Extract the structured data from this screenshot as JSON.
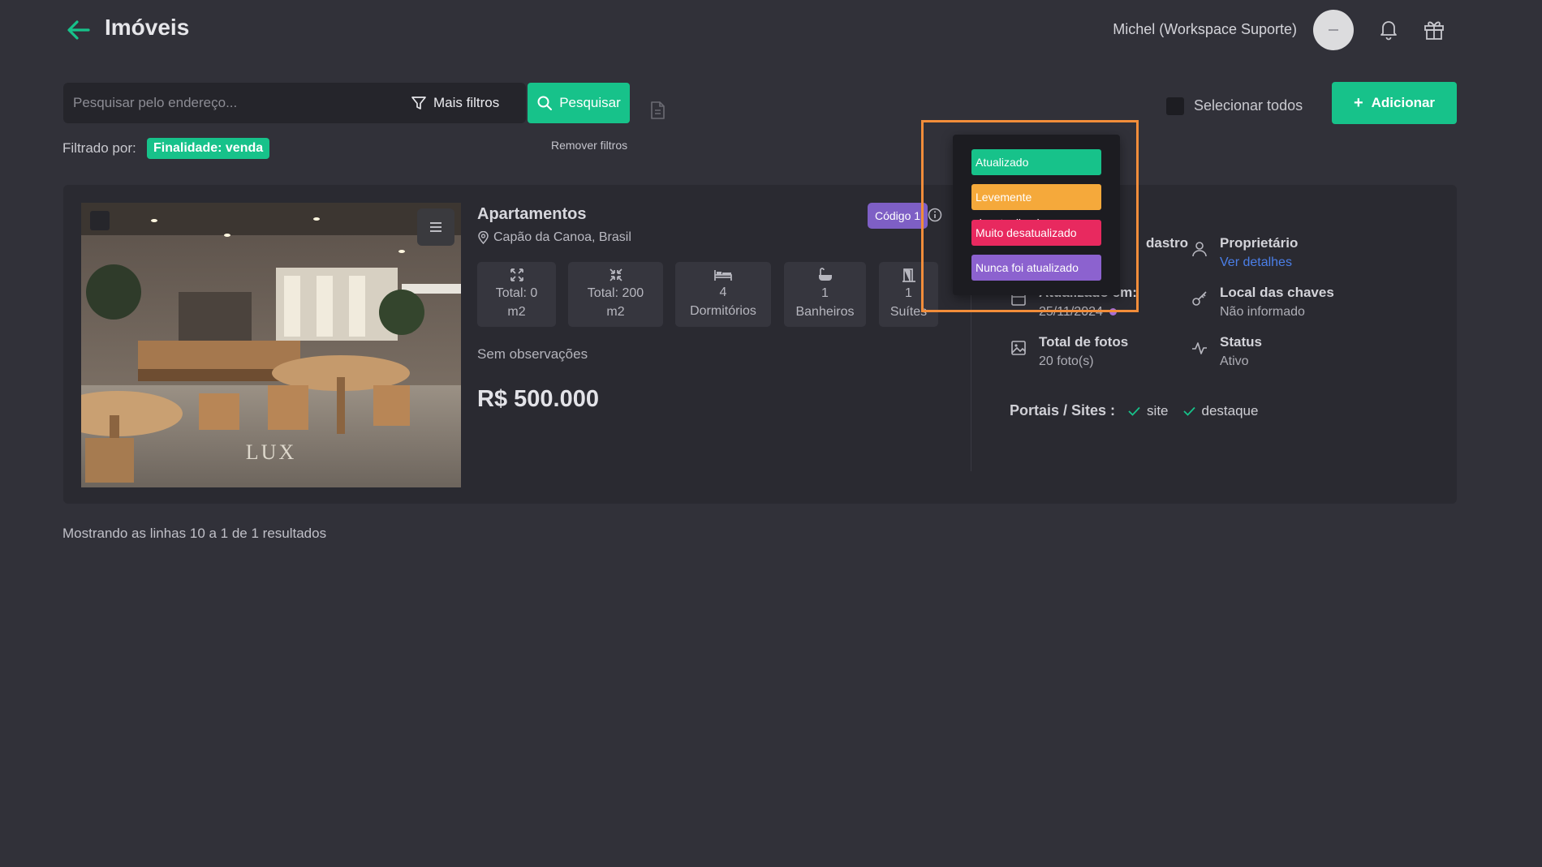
{
  "header": {
    "title": "Imóveis",
    "user_name": "Michel (Workspace Suporte)"
  },
  "search": {
    "placeholder": "Pesquisar pelo endereço...",
    "value": "",
    "more_filters_label": "Mais filtros",
    "search_button_label": "Pesquisar"
  },
  "toolbar": {
    "select_all_label": "Selecionar todos",
    "add_button_label": "Adicionar"
  },
  "filters": {
    "filtered_by_label": "Filtrado por:",
    "active_filter": "Finalidade: venda",
    "remove_filters_label": "Remover filtros"
  },
  "property": {
    "type": "Apartamentos",
    "location": "Capão da Canoa, Brasil",
    "code": "Código 1",
    "features": [
      {
        "icon": "expand-icon",
        "line1": "Total: 0",
        "line2": "m2"
      },
      {
        "icon": "compress-icon",
        "line1": "Total: 200",
        "line2": "m2"
      },
      {
        "icon": "bed-icon",
        "line1": "4",
        "line2": "Dormitórios"
      },
      {
        "icon": "bathtub-icon",
        "line1": "1",
        "line2": "Banheiros"
      },
      {
        "icon": "door-icon",
        "line1": "1",
        "line2": "Suítes"
      }
    ],
    "observations": "Sem observações",
    "price": "R$ 500.000",
    "photo_watermark": "LUX"
  },
  "details": {
    "cadastro_title_partial": "dastro",
    "updated_title": "Atualizado em:",
    "updated_value": "25/11/2024",
    "photos_title": "Total de fotos",
    "photos_value": "20 foto(s)",
    "owner_title": "Proprietário",
    "owner_link": "Ver detalhes",
    "keys_title": "Local das chaves",
    "keys_value": "Não informado",
    "status_title": "Status",
    "status_value": "Ativo",
    "portals_label": "Portais / Sites :",
    "portals": [
      "site",
      "destaque"
    ]
  },
  "status_legend": [
    {
      "label": "Atualizado",
      "color": "#17c28a"
    },
    {
      "label": "Levemente desatualizado",
      "color": "#f5a93b"
    },
    {
      "label": "Muito desatualizado",
      "color": "#e8295f"
    },
    {
      "label": "Nunca foi atualizado",
      "color": "#8c62cf"
    }
  ],
  "footer": {
    "results_text": "Mostrando as linhas 10 a 1 de 1 resultados"
  },
  "colors": {
    "accent": "#17c28a",
    "background": "#313139",
    "card": "#2a2a31",
    "code_badge": "#7e5fc5",
    "highlight": "#f28d3a"
  }
}
